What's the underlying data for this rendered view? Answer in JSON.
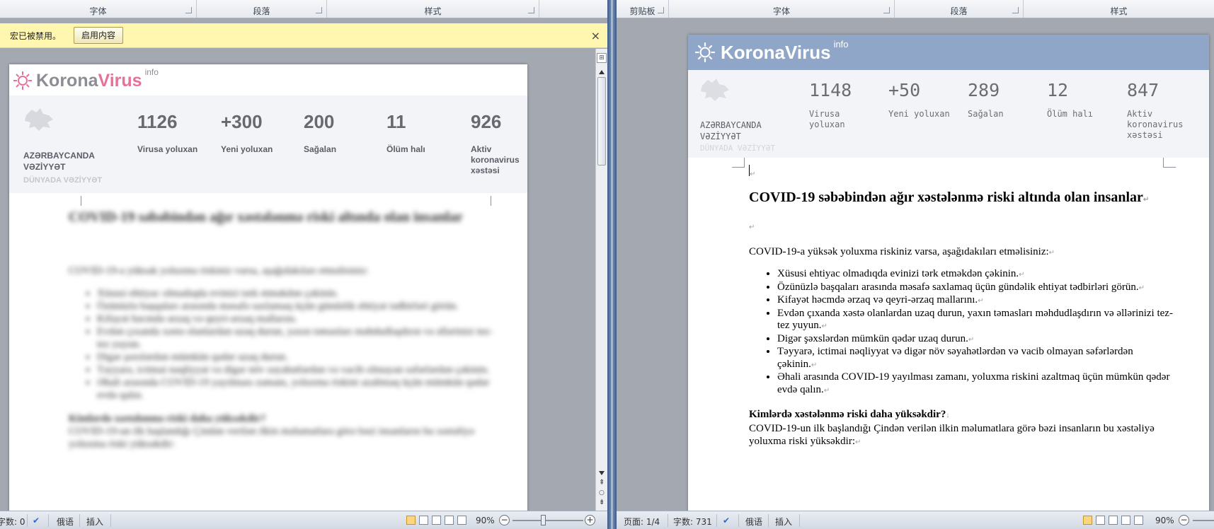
{
  "left_window": {
    "ribbon_groups": [
      "字体",
      "段落",
      "样式"
    ],
    "message_bar": {
      "message": "宏已被禁用。",
      "enable_button": "启用内容",
      "close": "×"
    },
    "banner": {
      "logo_korona": "Korona",
      "logo_virus": "Virus",
      "logo_info": "info",
      "region_line1": "AZƏRBAYCANDA",
      "region_line2": "VƏZİYYƏT",
      "world": "DÜNYADA VƏZİYYƏT",
      "stats": [
        {
          "value": "1126",
          "label": "Virusa yoluxan"
        },
        {
          "value": "+300",
          "label": "Yeni yoluxan"
        },
        {
          "value": "200",
          "label": "Sağalan"
        },
        {
          "value": "11",
          "label": "Ölüm halı"
        },
        {
          "value": "926",
          "label": "Aktiv koronavirus xəstəsi"
        }
      ]
    },
    "blurred_text": {
      "heading": "COVID-19 səbəbindən ağır xəstələnmə riski altında olan insanlar",
      "intro": "COVID-19-a yüksək yoluxma riskiniz varsa, aşağıdakıları etməlisiniz:",
      "bullets": [
        "Xüsusi ehtiyac olmadıqda evinizi tərk etməkdən çəkinin.",
        "Özünüzlə başqaları arasında məsafə saxlamaq üçün gündəlik ehtiyat tədbirləri görün.",
        "Kifayət həcmdə ərzaq və qeyri-ərzaq mallarını.",
        "Evdən çıxanda xəstə olanlardan uzaq durun, yaxın təmasları məhdudlaşdırın və əllərinizi tez-tez yuyun.",
        "Digər şəxslərdən mümkün qədər uzaq durun.",
        "Təyyarə, ictimai nəqliyyat və digər növ səyahətlərdən və vacib olmayan səfərlərdən çəkinin.",
        "Əhali arasında COVID-19 yayılması zamanı, yoluxma riskini azaltmaq üçün mümkün qədər evdə qalın."
      ],
      "subheading": "Kimlərdə xəstələnmə riski daha yüksəkdir?",
      "paragraph": "COVID-19-un ilk başlandığı Çindən verilən ilkin məlumatlara görə bəzi insanların bu xəstəliyə yoluxma riski yüksəkdir:"
    },
    "statusbar": {
      "words": "字数: 0",
      "language": "俄语",
      "mode": "插入",
      "zoom": "90%",
      "zoom_level_percent": 90
    }
  },
  "right_window": {
    "ribbon_groups": [
      "剪贴板",
      "字体",
      "段落",
      "样式"
    ],
    "banner": {
      "logo": "KoronaVirus",
      "logo_info": "info",
      "region_line1": "AZƏRBAYCANDA",
      "region_line2": "VƏZİYYƏT",
      "world": "DÜNYADA VƏZİYYƏT",
      "stats": [
        {
          "value": "1148",
          "label": "Virusa yoluxan"
        },
        {
          "value": "+50",
          "label": "Yeni yoluxan"
        },
        {
          "value": "289",
          "label": "Sağalan"
        },
        {
          "value": "12",
          "label": "Ölüm halı"
        },
        {
          "value": "847",
          "label": "Aktiv koronavirus xəstəsi"
        }
      ]
    },
    "document": {
      "heading": "COVID-19 səbəbindən ağır xəstələnmə riski altında olan insanlar",
      "intro": "COVID-19-a yüksək yoluxma riskiniz varsa, aşağıdakıları etməlisiniz:",
      "bullets": [
        "Xüsusi ehtiyac olmadıqda evinizi tərk etməkdən çəkinin.",
        "Özünüzlə başqaları arasında məsafə saxlamaq üçün gündəlik ehtiyat tədbirləri görün.",
        "Kifayət həcmdə ərzaq və qeyri-ərzaq mallarını.",
        "Evdən çıxanda xəstə olanlardan uzaq durun, yaxın təmasları məhdudlaşdırın və əllərinizi tez-tez yuyun.",
        "Digər şəxslərdən mümkün qədər uzaq durun.",
        "Təyyarə, ictimai nəqliyyat və digər növ səyahətlərdən və vacib olmayan səfərlərdən çəkinin.",
        "Əhali arasında COVID-19 yayılması zamanı, yoluxma riskini azaltmaq üçün mümkün qədər evdə qalın."
      ],
      "subheading": "Kimlərdə xəstələnmə riski daha yüksəkdir?",
      "paragraph": "COVID-19-un ilk başlandığı Çindən verilən ilkin məlumatlara görə bəzi insanların bu xəstəliyə yoluxma riski yüksəkdir:"
    },
    "statusbar": {
      "page": "页面: 1/4",
      "words": "字数: 731",
      "language": "俄语",
      "mode": "插入",
      "zoom": "90%",
      "zoom_level_percent": 90
    }
  },
  "colors": {
    "left_logo_accent": "#e8709a",
    "left_logo_gray": "#8b8e94",
    "right_banner_bg": "#8fa6c8",
    "stats_bg": "#f3f4f7",
    "message_bar_bg": "#fff7b0"
  }
}
